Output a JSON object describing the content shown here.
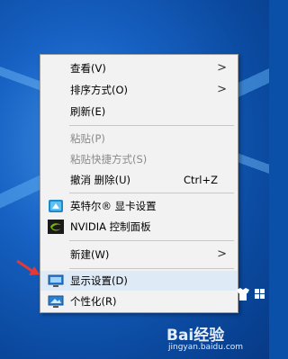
{
  "context_menu": {
    "items": [
      {
        "label": "查看(V)",
        "submenu": true
      },
      {
        "label": "排序方式(O)",
        "submenu": true
      },
      {
        "label": "刷新(E)"
      },
      {
        "label": "粘贴(P)",
        "disabled": true
      },
      {
        "label": "粘贴快捷方式(S)",
        "disabled": true
      },
      {
        "label": "撤消 删除(U)",
        "shortcut": "Ctrl+Z"
      },
      {
        "label": "英特尔® 显卡设置",
        "icon": "intel-graphics-icon"
      },
      {
        "label": "NVIDIA 控制面板",
        "icon": "nvidia-icon"
      },
      {
        "label": "新建(W)",
        "submenu": true
      },
      {
        "label": "显示设置(D)",
        "icon": "display-settings-icon"
      },
      {
        "label": "个性化(R)",
        "icon": "personalize-icon"
      }
    ]
  },
  "watermark": {
    "brand": "Bai经验",
    "url": "jingyan.baidu.com"
  },
  "colors": {
    "menu_bg": "#f2f2f2",
    "disabled_text": "#8a8a8a",
    "arrow": "#e53935",
    "desktop": "#0a4fa8"
  }
}
